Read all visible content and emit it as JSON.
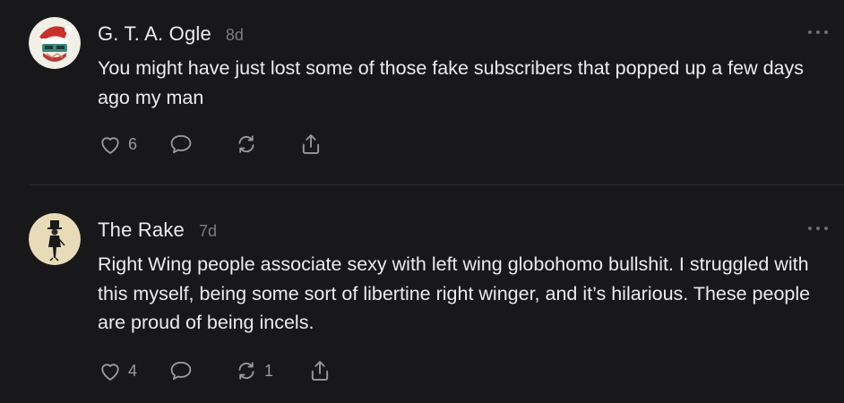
{
  "comments": [
    {
      "author": "G. T. A. Ogle",
      "time": "8d",
      "text": "You might have just lost some of those fake subscribers that popped up a few days ago my man",
      "likes": "6",
      "restacks": ""
    },
    {
      "author": "The Rake",
      "time": "7d",
      "text": "Right Wing people associate sexy with left wing globohomo bullshit. I struggled with this myself, being some sort of libertine right winger, and it’s hilarious. These people are proud of being incels.",
      "likes": "4",
      "restacks": "1"
    }
  ],
  "icons": {
    "like": "heart-icon",
    "reply": "speech-bubble-icon",
    "restack": "restack-arrows-icon",
    "share": "share-icon",
    "more": "ellipsis-icon"
  },
  "colors": {
    "background": "#18181a",
    "text": "#ececec",
    "muted": "#7d7d80",
    "icon": "#9a9a9e",
    "divider": "#2e2e31"
  }
}
